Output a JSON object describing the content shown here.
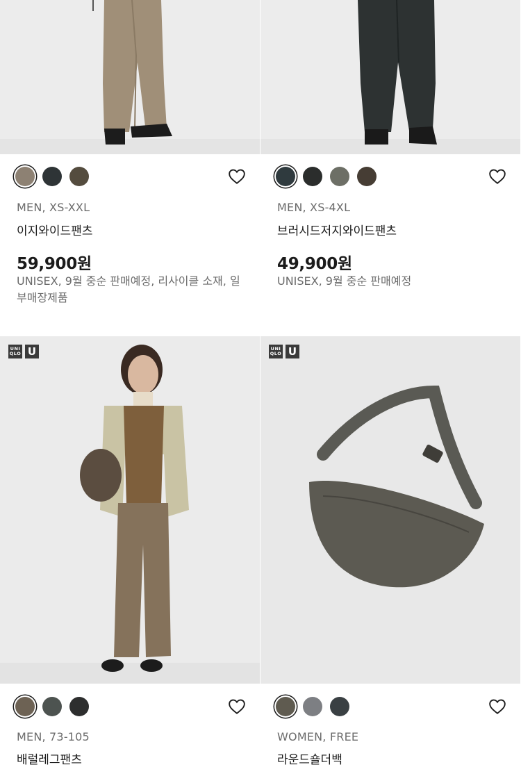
{
  "products": [
    {
      "swatch_colors": [
        "#8d8173",
        "#2e3436",
        "#544c3e"
      ],
      "meta": "MEN, XS-XXL",
      "name": "이지와이드팬츠",
      "price": "59,900원",
      "note": "UNISEX, 9월 중순 판매예정, 리사이클 소재, 일부매장제품"
    },
    {
      "swatch_colors": [
        "#2f3a3e",
        "#2b2d2c",
        "#6d6f66",
        "#463d34"
      ],
      "meta": "MEN, XS-4XL",
      "name": "브러시드저지와이드팬츠",
      "price": "49,900원",
      "note": "UNISEX, 9월 중순 판매예정"
    },
    {
      "logo": {
        "badge": "UNI QLO",
        "u": "U"
      },
      "swatch_colors": [
        "#6d6254",
        "#4d5350",
        "#2d2e2e"
      ],
      "meta": "MEN, 73-105",
      "name": "배럴레그팬츠"
    },
    {
      "logo": {
        "badge": "UNI QLO",
        "u": "U"
      },
      "swatch_colors": [
        "#5f5b50",
        "#7d7f83",
        "#3a4043"
      ],
      "meta": "WOMEN, FREE",
      "name": "라운드숄더백"
    }
  ],
  "icons": {
    "favorite": "heart-outline-icon"
  }
}
